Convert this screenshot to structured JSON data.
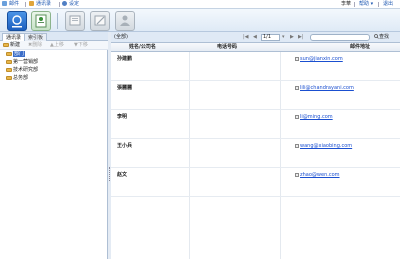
{
  "topbar": {
    "mail": "邮件",
    "contacts": "通讯录",
    "settings": "设定",
    "user": "李華",
    "help": "帮助",
    "logout": "退出"
  },
  "sidebar": {
    "tabs": [
      "通讯录",
      "索引板"
    ],
    "actions": {
      "new": "新建",
      "delete": "删除",
      "move_up": "上移",
      "move_down": "下移"
    },
    "tree": [
      {
        "label": "部门",
        "level": 1,
        "selected": true
      },
      {
        "label": "第一营销部",
        "level": 1,
        "selected": false
      },
      {
        "label": "技术研究部",
        "level": 1,
        "selected": false
      },
      {
        "label": "总务部",
        "level": 1,
        "selected": false
      }
    ],
    "root_label": "新建"
  },
  "header": {
    "title": "(全部)",
    "page": "1/1",
    "search_button": "查找"
  },
  "table": {
    "columns": [
      "姓名/公司名",
      "电话号码",
      "邮件地址"
    ],
    "rows": [
      {
        "name": "孙建鹏",
        "phone": "",
        "email": "sun@jianxin.com"
      },
      {
        "name": "張麗麗",
        "phone": "",
        "email": "lili@chandrayani.com"
      },
      {
        "name": "李明",
        "phone": "",
        "email": "li@ming.com"
      },
      {
        "name": "王小兵",
        "phone": "",
        "email": "wang@xiaobing.com"
      },
      {
        "name": "赵文",
        "phone": "",
        "email": "zhao@wen.com"
      }
    ]
  },
  "colors": {
    "link": "#1a55b0",
    "selected": "#3c6ec8",
    "folder": "#e8b64a"
  }
}
